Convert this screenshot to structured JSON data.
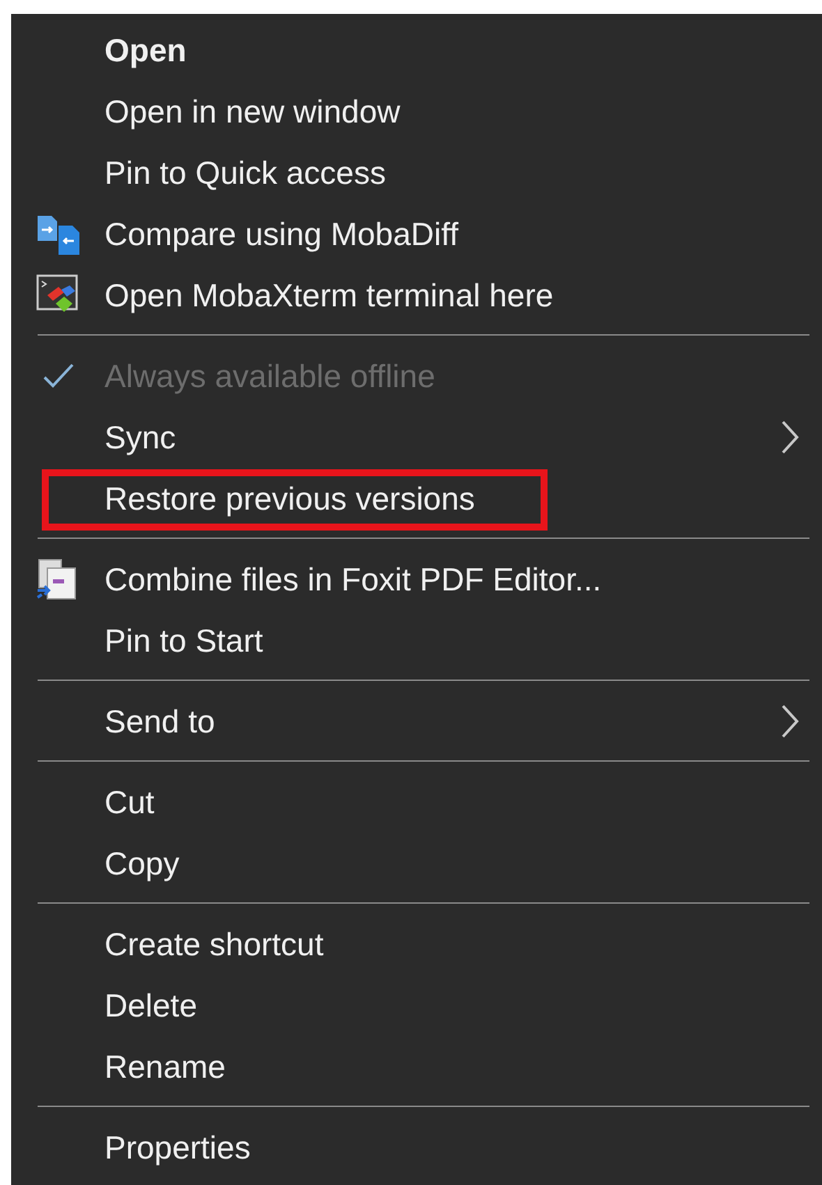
{
  "menu": {
    "items": [
      {
        "kind": "item",
        "label": "Open",
        "default": true,
        "disabled": false,
        "checked": false,
        "submenu": false,
        "annotated": false
      },
      {
        "kind": "item",
        "label": "Open in new window",
        "default": false,
        "disabled": false,
        "checked": false,
        "submenu": false,
        "annotated": false
      },
      {
        "kind": "item",
        "label": "Pin to Quick access",
        "default": false,
        "disabled": false,
        "checked": false,
        "submenu": false,
        "annotated": false
      },
      {
        "kind": "item",
        "label": "Compare using MobaDiff",
        "default": false,
        "disabled": false,
        "checked": false,
        "submenu": false,
        "annotated": false
      },
      {
        "kind": "item",
        "label": "Open MobaXterm terminal here",
        "default": false,
        "disabled": false,
        "checked": false,
        "submenu": false,
        "annotated": false
      },
      {
        "kind": "separator"
      },
      {
        "kind": "item",
        "label": "Always available offline",
        "default": false,
        "disabled": true,
        "checked": true,
        "submenu": false,
        "annotated": false
      },
      {
        "kind": "item",
        "label": "Sync",
        "default": false,
        "disabled": false,
        "checked": false,
        "submenu": true,
        "annotated": false
      },
      {
        "kind": "item",
        "label": "Restore previous versions",
        "default": false,
        "disabled": false,
        "checked": false,
        "submenu": false,
        "annotated": true
      },
      {
        "kind": "separator"
      },
      {
        "kind": "item",
        "label": "Combine files in Foxit PDF Editor...",
        "default": false,
        "disabled": false,
        "checked": false,
        "submenu": false,
        "annotated": false
      },
      {
        "kind": "item",
        "label": "Pin to Start",
        "default": false,
        "disabled": false,
        "checked": false,
        "submenu": false,
        "annotated": false
      },
      {
        "kind": "separator"
      },
      {
        "kind": "item",
        "label": "Send to",
        "default": false,
        "disabled": false,
        "checked": false,
        "submenu": true,
        "annotated": false
      },
      {
        "kind": "separator"
      },
      {
        "kind": "item",
        "label": "Cut",
        "default": false,
        "disabled": false,
        "checked": false,
        "submenu": false,
        "annotated": false
      },
      {
        "kind": "item",
        "label": "Copy",
        "default": false,
        "disabled": false,
        "checked": false,
        "submenu": false,
        "annotated": false
      },
      {
        "kind": "separator"
      },
      {
        "kind": "item",
        "label": "Create shortcut",
        "default": false,
        "disabled": false,
        "checked": false,
        "submenu": false,
        "annotated": false
      },
      {
        "kind": "item",
        "label": "Delete",
        "default": false,
        "disabled": false,
        "checked": false,
        "submenu": false,
        "annotated": false
      },
      {
        "kind": "item",
        "label": "Rename",
        "default": false,
        "disabled": false,
        "checked": false,
        "submenu": false,
        "annotated": false
      },
      {
        "kind": "separator"
      },
      {
        "kind": "item",
        "label": "Properties",
        "default": false,
        "disabled": false,
        "checked": false,
        "submenu": false,
        "annotated": false
      }
    ]
  }
}
